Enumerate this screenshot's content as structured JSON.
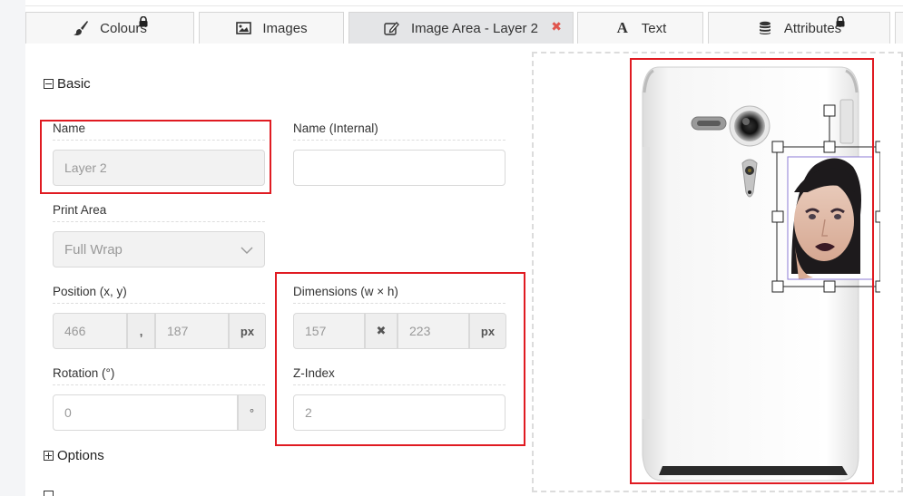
{
  "tabs": [
    {
      "label": "Colours",
      "icon": "brush-icon",
      "locked": true
    },
    {
      "label": "Images",
      "icon": "image-icon",
      "locked": false
    },
    {
      "label": "Image Area - Layer 2",
      "icon": "edit-icon",
      "locked": false,
      "closable": true,
      "active": true
    },
    {
      "label": "Text",
      "icon": "font-icon",
      "locked": false
    },
    {
      "label": "Attributes",
      "icon": "database-icon",
      "locked": true
    }
  ],
  "sections": {
    "basic": "Basic",
    "options": "Options"
  },
  "form": {
    "name": {
      "label": "Name",
      "placeholder": "Layer 2"
    },
    "name_internal": {
      "label": "Name (Internal)",
      "value": ""
    },
    "print_area": {
      "label": "Print Area",
      "value": "Full Wrap"
    },
    "position": {
      "label": "Position (x, y)",
      "x": "466",
      "separator": ",",
      "y": "187",
      "unit": "px"
    },
    "dimensions": {
      "label": "Dimensions (w × h)",
      "w": "157",
      "separator": "✖",
      "h": "223",
      "unit": "px"
    },
    "rotation": {
      "label": "Rotation (°)",
      "value": "0",
      "unit": "°"
    },
    "zindex": {
      "label": "Z-Index",
      "value": "2"
    }
  },
  "colors": {
    "highlight": "#e01b22",
    "selection_purple": "#8c7bd6"
  }
}
